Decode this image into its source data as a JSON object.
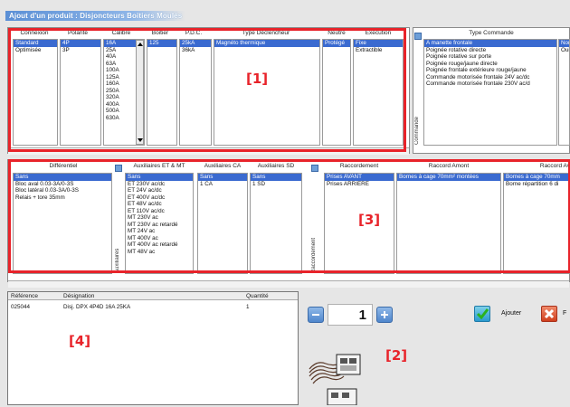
{
  "window": {
    "title": "Ajout d'un produit : Disjoncteurs Boitiers Moulés"
  },
  "top": {
    "headers": [
      "Connexion",
      "Polarité",
      "Calibre",
      "Boitier",
      "P.D.C.",
      "Type Déclencheur",
      "Neutre",
      "Execution"
    ],
    "connexion": [
      "Standard",
      "Optimisée"
    ],
    "polarite": [
      "4P",
      "3P"
    ],
    "calibre": [
      "16A",
      "25A",
      "40A",
      "63A",
      "100A",
      "125A",
      "160A",
      "250A",
      "320A",
      "400A",
      "500A",
      "630A"
    ],
    "boitier": [
      "125"
    ],
    "pdc": [
      "25kA",
      "36kA"
    ],
    "declencheur": [
      "Magnéto thermique"
    ],
    "neutre": [
      "Protégé"
    ],
    "execution": [
      "Fixe",
      "Extractible"
    ]
  },
  "commande": {
    "header": "Type Commande",
    "side_label": "Commande",
    "items": [
      "A manette frontale",
      "Poignée rotative directe",
      "Poignée rotative sur porte",
      "Poignée rouge/jaune directe",
      "Poignée frontale extérieure rouge/jaune",
      "Commande motorisée frontale 24V ac/dc",
      "Commande motorisée frontale 230V ac/d"
    ],
    "extra_header": "",
    "extra_items": [
      "Non",
      "Oui"
    ]
  },
  "middle": {
    "differentiel_header": "Différentiel",
    "differentiel": [
      "Sans",
      "Bloc aval 0.03-3A/0-3S",
      "Bloc latéral 0.03-3A/0-3S",
      "Relais + tore 35mm"
    ],
    "aux_label": "Auxiliaires",
    "aux_et_header": "Auxiliaires ET & MT",
    "aux_et": [
      "Sans",
      "ET 230V ac/dc",
      "ET 24V ac/dc",
      "ET 400V ac/dc",
      "ET 48V ac/dc",
      "ET 110V ac/dc",
      "MT 230V ac",
      "MT 230V ac retardé",
      "MT 24V ac",
      "MT 400V ac",
      "MT 400V ac retardé",
      "MT 48V ac"
    ],
    "aux_ca_header": "Auxiliaires CA",
    "aux_ca": [
      "Sans",
      "1 CA"
    ],
    "aux_sd_header": "Auxiliaires SD",
    "aux_sd": [
      "Sans",
      "1 SD"
    ],
    "raccord_label": "Raccordement",
    "raccord_header": "Raccordement",
    "raccord": [
      "Prises AVANT",
      "Prises ARRIERE"
    ],
    "amont_header": "Raccord Amont",
    "amont": [
      "Bornes à cage 70mm² montées"
    ],
    "aval_header": "Raccord Av",
    "aval": [
      "Bornes à cage 70mm",
      "Borne répartition 6 di"
    ]
  },
  "bottom": {
    "headers": {
      "ref": "Référence",
      "designation": "Désignation",
      "qty": "Quantité"
    },
    "rows": [
      {
        "ref": "025044",
        "designation": "Disj. DPX 4P4D 16A 25KA",
        "qty": "1"
      }
    ],
    "quantity": "1",
    "add_label": "Ajouter",
    "close_label": "F"
  },
  "callouts": {
    "c1": "[1]",
    "c2": "[2]",
    "c3": "[3]",
    "c4": "[4]"
  }
}
